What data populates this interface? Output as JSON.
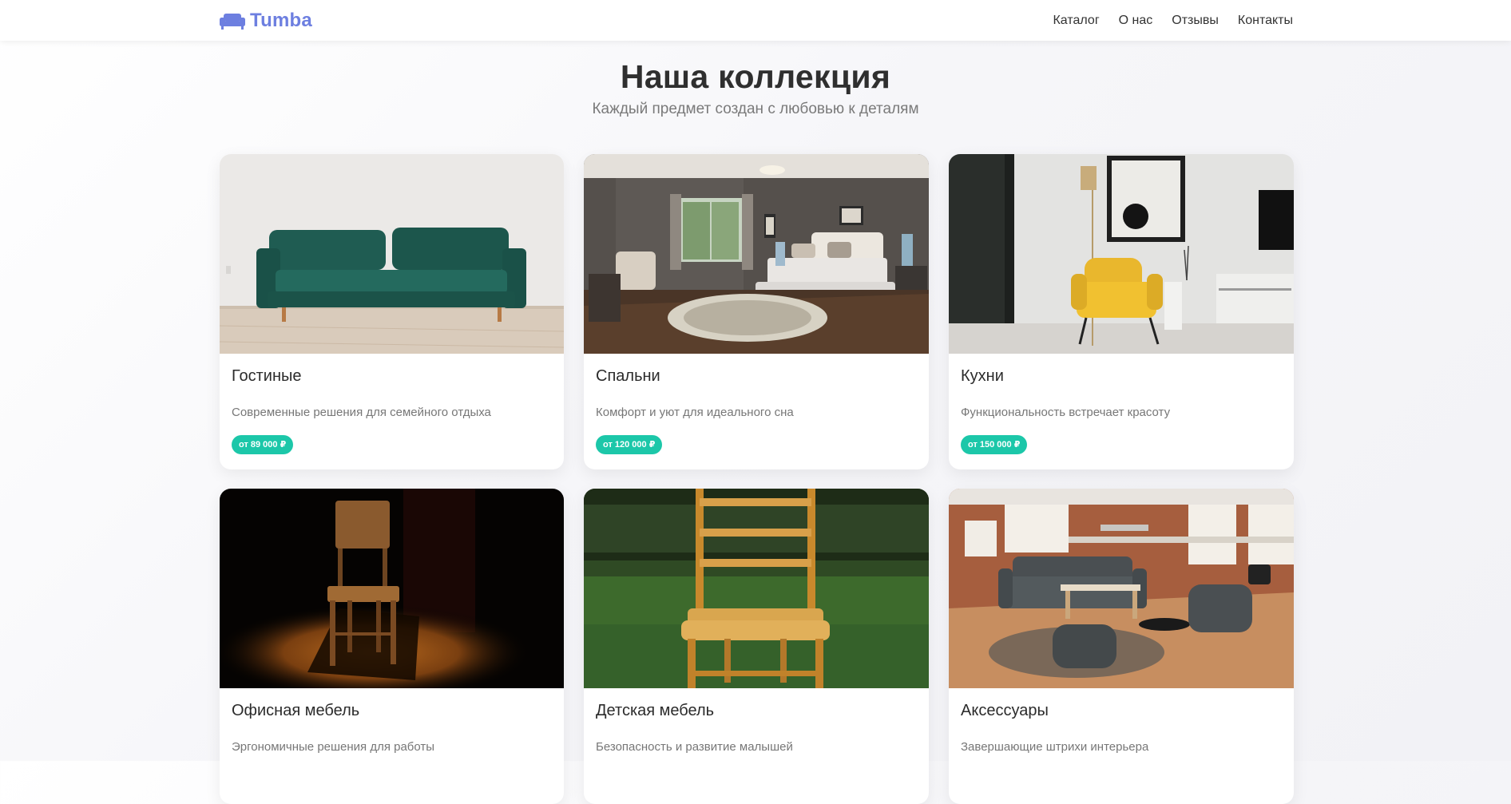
{
  "brand": {
    "name": "Tumba",
    "icon": "sofa-icon",
    "color": "#6d7fe0"
  },
  "nav": {
    "items": [
      {
        "label": "Каталог"
      },
      {
        "label": "О нас"
      },
      {
        "label": "Отзывы"
      },
      {
        "label": "Контакты"
      }
    ]
  },
  "hero": {
    "title": "Наша коллекция",
    "subtitle": "Каждый предмет создан с любовью к деталям"
  },
  "colors": {
    "accent": "#1cc7a9"
  },
  "cards": [
    {
      "title": "Гостиные",
      "description": "Современные решения для семейного отдыха",
      "price": "от 89 000 ₽",
      "image": "green-sofa-photo"
    },
    {
      "title": "Спальни",
      "description": "Комфорт и уют для идеального сна",
      "price": "от 120 000 ₽",
      "image": "bedroom-photo"
    },
    {
      "title": "Кухни",
      "description": "Функциональность встречает красоту",
      "price": "от 150 000 ₽",
      "image": "yellow-armchair-photo"
    },
    {
      "title": "Офисная мебель",
      "description": "Эргономичные решения для работы",
      "price": "",
      "image": "wooden-chair-spotlight-photo"
    },
    {
      "title": "Детская мебель",
      "description": "Безопасность и развитие малышей",
      "price": "",
      "image": "wooden-chair-grass-photo"
    },
    {
      "title": "Аксессуары",
      "description": "Завершающие штрихи интерьера",
      "price": "",
      "image": "loft-lounge-photo"
    }
  ]
}
